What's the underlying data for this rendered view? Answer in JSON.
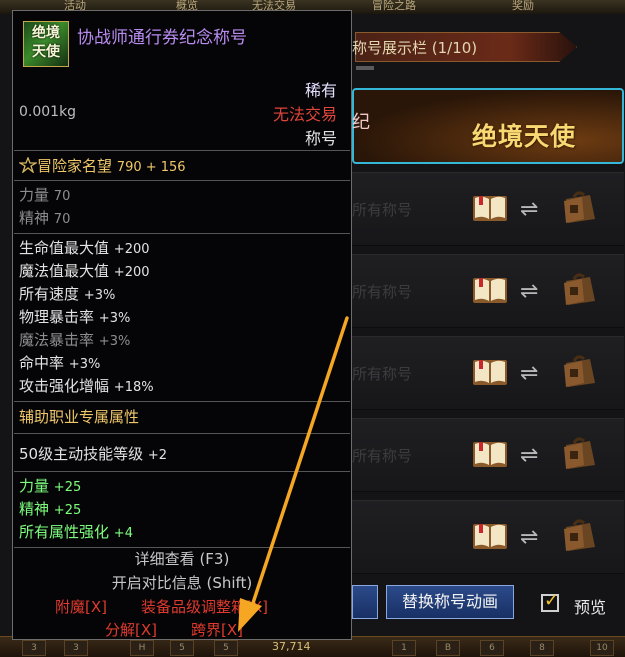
{
  "bg": {
    "title_bar_text": "称号展示栏 (1/10)",
    "selected_suffix": "纪",
    "selected_title": "绝境天使",
    "rows": [
      {
        "ghost": "所有称号"
      },
      {
        "ghost": "所有称号"
      },
      {
        "ghost": "所有称号"
      },
      {
        "ghost": "所有称号"
      },
      {
        "ghost": ""
      }
    ],
    "replace_anim_btn": "替换称号动画",
    "preview_label": "预览",
    "preview_checked": true,
    "topbar_tabs": [
      "活动",
      "概览",
      "无法交易",
      "冒险之路",
      "奖励"
    ],
    "bottom_slots": [
      "3",
      "3",
      "H",
      "5",
      "5",
      "1",
      "B",
      "6",
      "8",
      "10"
    ],
    "bottom_gold": "37,714"
  },
  "tooltip": {
    "icon_text": "绝境天使",
    "item_name": "协战师通行券纪念称号",
    "rarity": "稀有",
    "tradability": "无法交易",
    "category": "称号",
    "weight": "0.001kg",
    "reputation_label": "冒险家名望",
    "reputation_value": "790 + 156",
    "base_stats": [
      {
        "label": "力量",
        "value": "70"
      },
      {
        "label": "精神",
        "value": "70"
      }
    ],
    "stats": [
      {
        "label": "生命值最大值",
        "value": "+200",
        "active": true
      },
      {
        "label": "魔法值最大值",
        "value": "+200",
        "active": true
      },
      {
        "label": "所有速度",
        "value": "+3%",
        "active": true
      },
      {
        "label": "物理暴击率",
        "value": "+3%",
        "active": true
      },
      {
        "label": "魔法暴击率",
        "value": "+3%",
        "active": false
      },
      {
        "label": "命中率",
        "value": "+3%",
        "active": true
      },
      {
        "label": "攻击强化增幅",
        "value": "+18%",
        "active": true
      }
    ],
    "support_header": "辅助职业专属属性",
    "skill_line": {
      "label": "50级主动技能等级",
      "value": "+2"
    },
    "green_stats": [
      {
        "label": "力量",
        "value": "+25"
      },
      {
        "label": "精神",
        "value": "+25"
      },
      {
        "label": "所有属性强化",
        "value": "+4"
      }
    ],
    "detail_view": "详细查看 (F3)",
    "compare_info": "开启对比信息 (Shift)",
    "enchant": "附魔[X]",
    "adjust_box": "装备品级调整箱[X]",
    "disassemble": "分解[X]",
    "cross_realm": "跨界[X]"
  },
  "colors": {
    "rarity": "#e6e0ff",
    "untradable": "#e0453a",
    "name": "#b98cf0",
    "highlight_border": "#35b8d8",
    "arrow": "#f5a623"
  }
}
